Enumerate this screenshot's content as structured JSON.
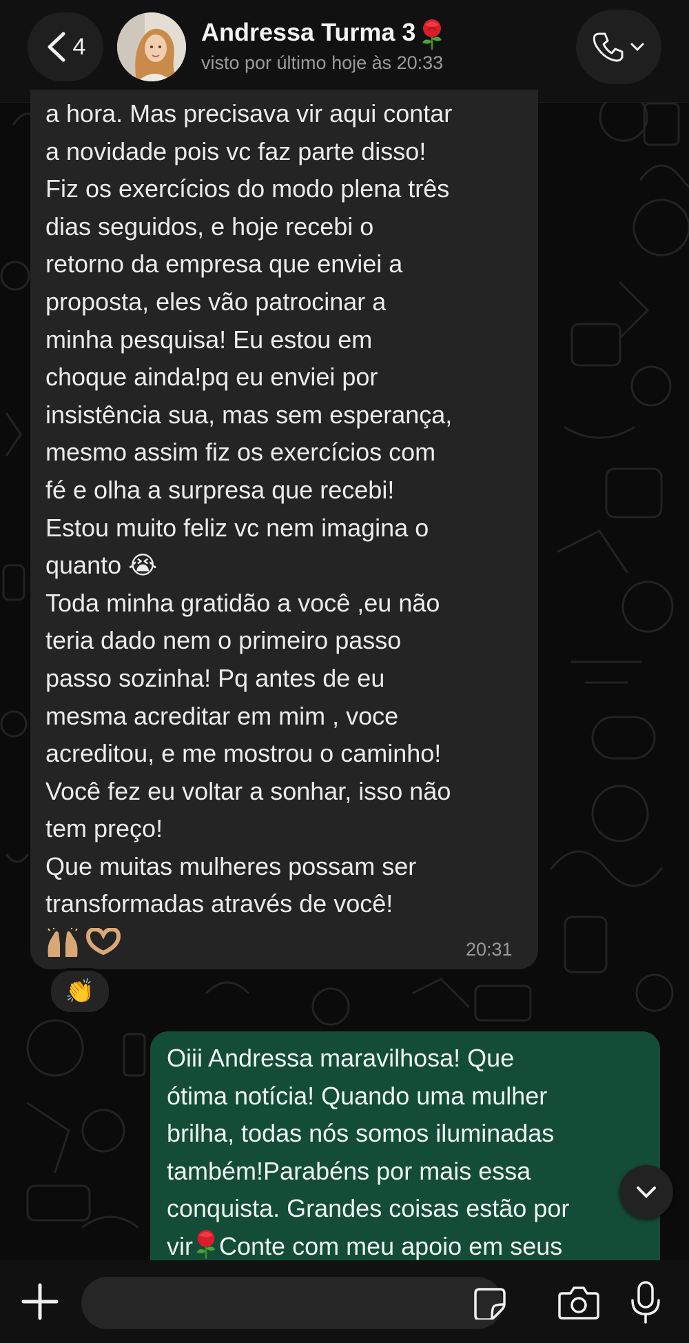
{
  "header": {
    "back_count": "4",
    "contact_name": "Andressa Turma 3",
    "last_seen": "visto por último hoje às 20:33"
  },
  "messages": {
    "received": {
      "text": "a hora. Mas precisava vir aqui contar\na novidade pois vc faz parte disso!\nFiz os exercícios do modo plena três\ndias seguidos, e hoje recebi o\nretorno da empresa que enviei a\nproposta, eles vão patrocinar a\nminha pesquisa! Eu estou em\nchoque ainda!pq eu enviei por\ninsistência sua, mas sem esperança,\nmesmo assim fiz os exercícios com\nfé e olha a surpresa que recebi!\nEstou muito feliz vc nem imagina o\nquanto 😭\nToda minha gratidão a você ,eu não\nteria dado nem o primeiro passo\npasso sozinha! Pq antes de eu\nmesma acreditar em mim , voce\nacreditou, e me mostrou o caminho!\nVocê fez eu voltar a sonhar, isso não\ntem preço!\nQue muitas mulheres possam ser\ntransformadas através de você!",
      "emojis": "🙌🏼🫶🏼",
      "time": "20:31",
      "reaction": "👏"
    },
    "sent": {
      "text_part1": "Oiii Andressa maravilhosa! Que\nótima notícia! Quando uma mulher\nbrilha, todas nós somos iluminadas\ntambém!Parabéns por mais essa\nconquista. Grandes coisas estão por\nvir",
      "text_part2": "Conte com meu apoio em seus"
    }
  },
  "input": {
    "placeholder": ""
  },
  "colors": {
    "background": "#0b0b0b",
    "header": "#111111",
    "bubble_in": "#242424",
    "bubble_out": "#144d37"
  },
  "icons": [
    "chevron-left-icon",
    "phone-icon",
    "chevron-down-icon",
    "plus-icon",
    "sticker-icon",
    "camera-icon",
    "microphone-icon",
    "rose-emoji"
  ]
}
